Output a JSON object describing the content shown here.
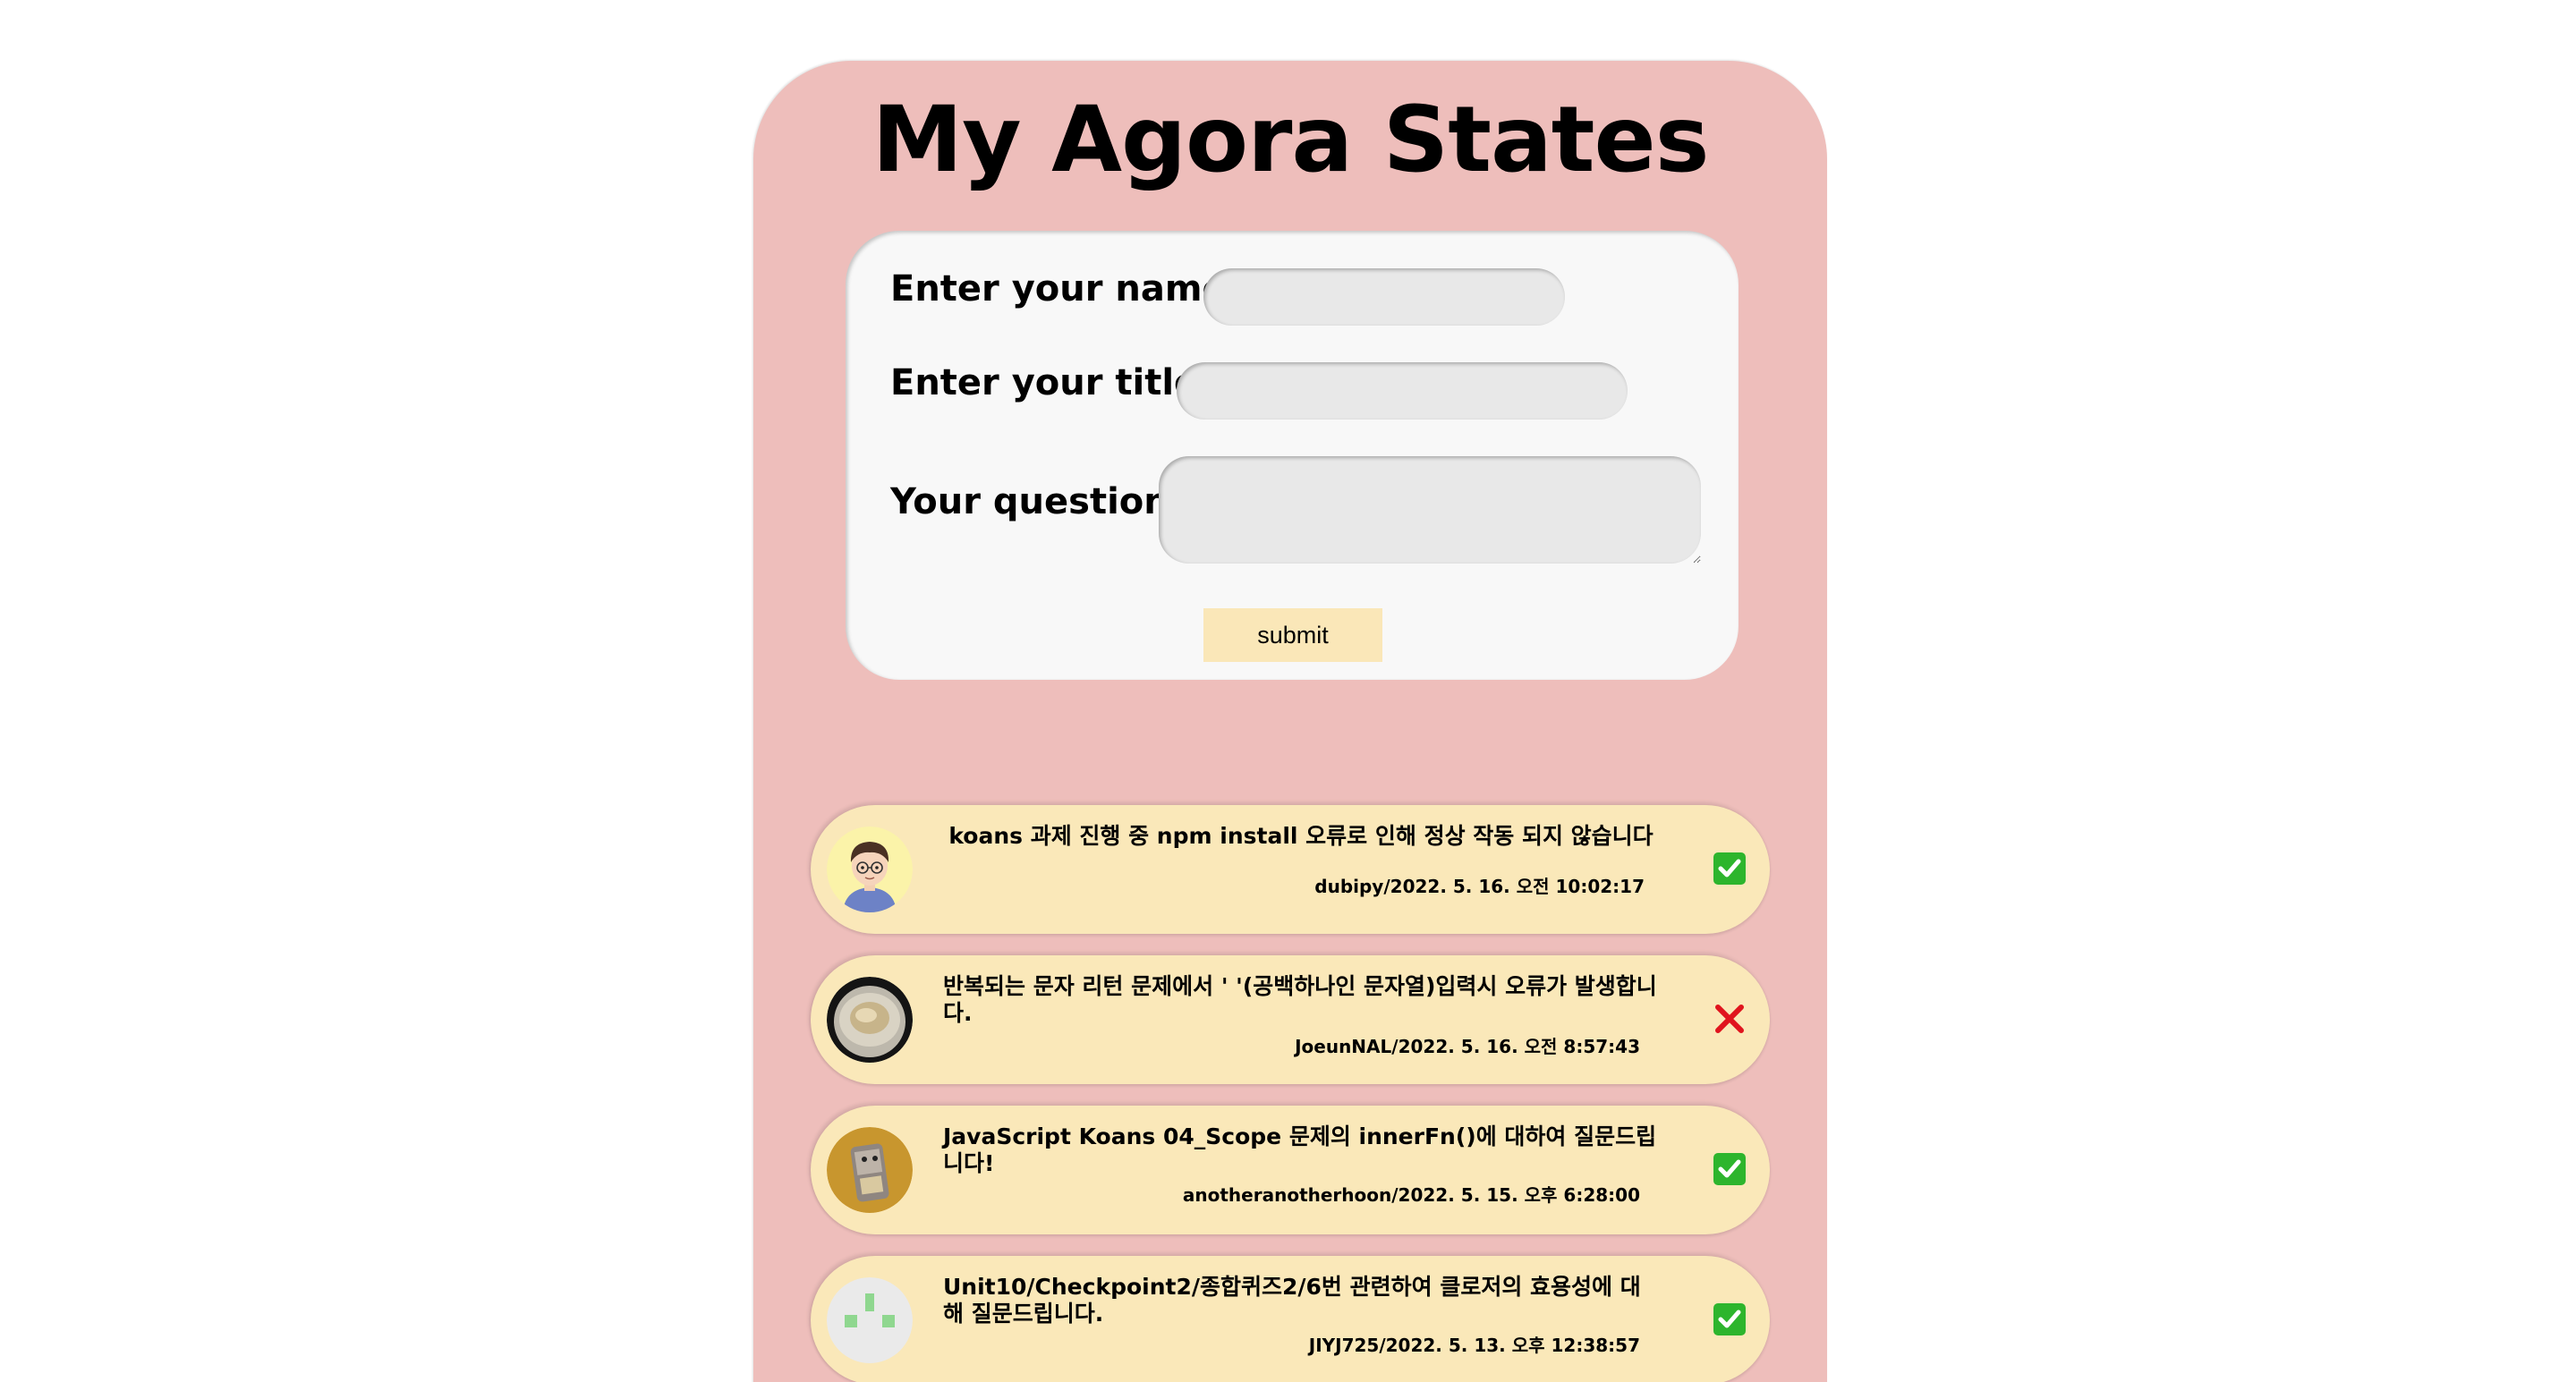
{
  "header": {
    "title": "My Agora States"
  },
  "form": {
    "name_label": "Enter your name:",
    "title_label": "Enter your title:",
    "question_label": "Your question:",
    "name_value": "",
    "title_value": "",
    "question_value": "",
    "submit_label": "submit"
  },
  "discussions": [
    {
      "title": "koans 과제 진행 중 npm install 오류로 인해 정상 작동 되지 않습니다",
      "info": "dubipy/2022. 5. 16. 오전 10:02:17",
      "status_icon": "check-mark-icon",
      "answered": true
    },
    {
      "title": "반복되는 문자 리턴 문제에서 ' '(공백하나인 문자열)입력시 오류가 발생합니다.",
      "info": "JoeunNAL/2022. 5. 16. 오전 8:57:43",
      "status_icon": "cross-mark-icon",
      "answered": false
    },
    {
      "title": "JavaScript Koans 04_Scope 문제의 innerFn()에 대하여 질문드립니다!",
      "info": "anotheranotherhoon/2022. 5. 15. 오후 6:28:00",
      "status_icon": "check-mark-icon",
      "answered": true
    },
    {
      "title": "Unit10/Checkpoint2/종합퀴즈2/6번 관련하여 클로저의 효용성에 대해 질문드립니다.",
      "info": "JIYJ725/2022. 5. 13. 오후 12:38:57",
      "status_icon": "check-mark-icon",
      "answered": true
    }
  ],
  "colors": {
    "page_bg": "#eebebb",
    "form_bg": "#f8f8f8",
    "card_bg": "#fae8b9",
    "check_green": "#2db52d",
    "cross_red": "#e0141e"
  }
}
